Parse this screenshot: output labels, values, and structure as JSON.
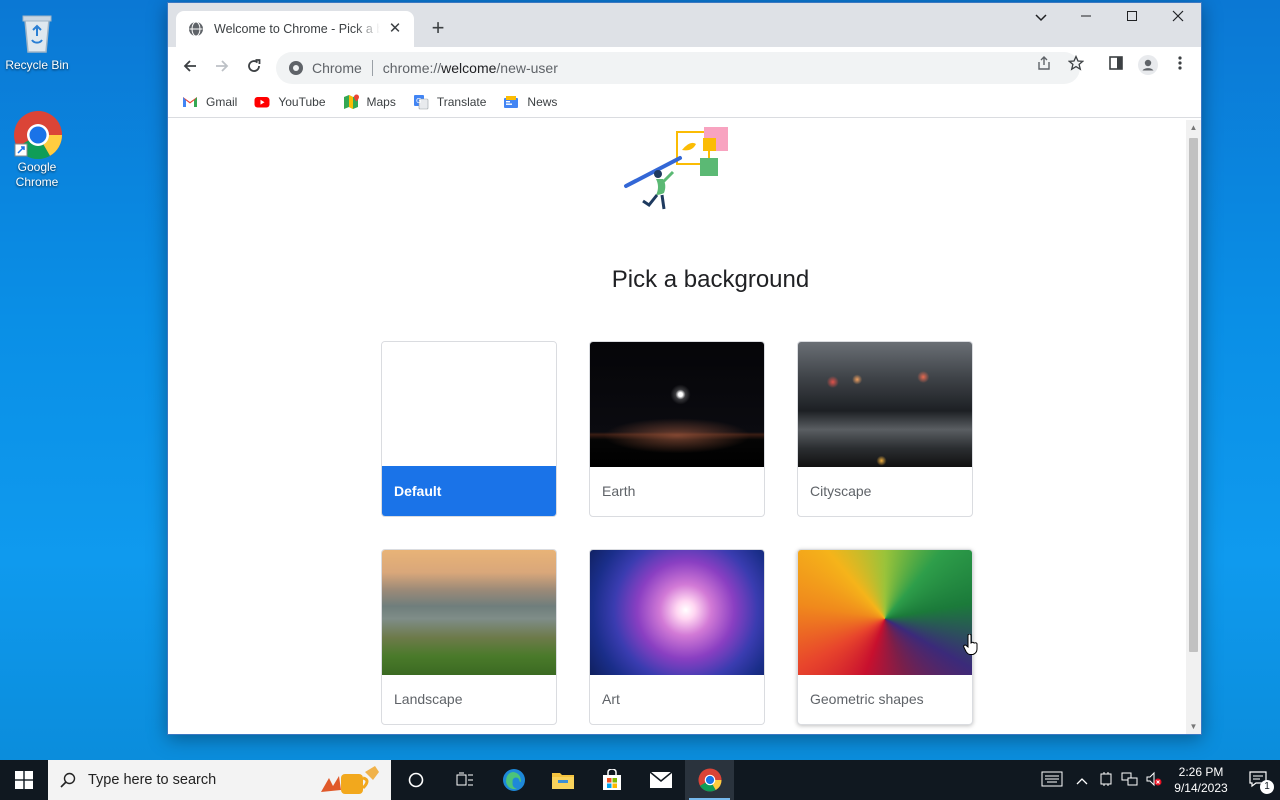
{
  "desktop": {
    "icons": [
      {
        "label": "Recycle Bin"
      },
      {
        "label": "Google Chrome"
      }
    ]
  },
  "browser": {
    "tab": {
      "title": "Welcome to Chrome - Pick a background"
    },
    "omnibox": {
      "chip": "Chrome",
      "url_prefix": "chrome://",
      "url_host": "welcome",
      "url_path": "/new-user"
    },
    "bookmarks": [
      {
        "label": "Gmail",
        "icon": "gmail-icon"
      },
      {
        "label": "YouTube",
        "icon": "youtube-icon"
      },
      {
        "label": "Maps",
        "icon": "maps-icon"
      },
      {
        "label": "Translate",
        "icon": "translate-icon"
      },
      {
        "label": "News",
        "icon": "news-icon"
      }
    ]
  },
  "page": {
    "heading": "Pick a background",
    "backgrounds": [
      {
        "label": "Default",
        "selected": true
      },
      {
        "label": "Earth",
        "selected": false
      },
      {
        "label": "Cityscape",
        "selected": false
      },
      {
        "label": "Landscape",
        "selected": false
      },
      {
        "label": "Art",
        "selected": false
      },
      {
        "label": "Geometric shapes",
        "selected": false
      }
    ]
  },
  "taskbar": {
    "search_placeholder": "Type here to search",
    "time": "2:26 PM",
    "date": "9/14/2023",
    "notification_count": "1"
  },
  "colors": {
    "accent": "#1a73e8",
    "desktop": "#0a8fe6",
    "taskbar": "#101820"
  }
}
